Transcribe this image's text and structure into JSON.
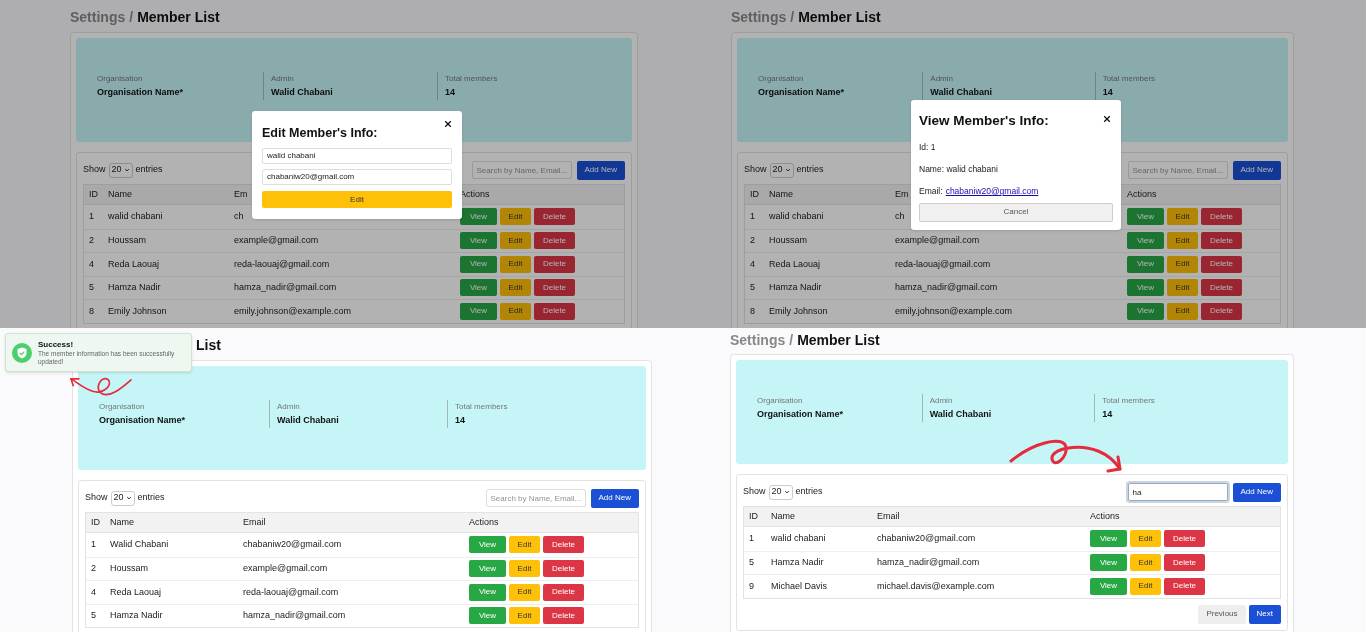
{
  "panels": [
    {
      "breadcrumb": {
        "parent": "Settings",
        "separator": "/",
        "current": "Member List"
      },
      "summary": [
        {
          "label": "Organisation",
          "value": "Organisation Name*"
        },
        {
          "label": "Admin",
          "value": "Walid Chabani"
        },
        {
          "label": "Total members",
          "value": "14"
        }
      ],
      "toolbar": {
        "show": "Show",
        "page_size": "20",
        "entries": "entries",
        "search": {
          "placeholder": "Search by Name, Email...",
          "focused": false
        },
        "add_button": "Add New"
      },
      "table": {
        "columns": [
          "ID",
          "Name",
          "Em",
          "Actions"
        ],
        "rows": [
          {
            "id": "1",
            "name": "walid chabani",
            "email": "ch",
            "actions": [
              "View",
              "Edit",
              "Delete"
            ]
          },
          {
            "id": "2",
            "name": "Houssam",
            "email": "example@gmail.com",
            "actions": [
              "View",
              "Edit",
              "Delete"
            ]
          },
          {
            "id": "4",
            "name": "Reda Laouaj",
            "email": "reda-laouaj@gmail.com",
            "actions": [
              "View",
              "Edit",
              "Delete"
            ]
          },
          {
            "id": "5",
            "name": "Hamza Nadir",
            "email": "hamza_nadir@gmail.com",
            "actions": [
              "View",
              "Edit",
              "Delete"
            ]
          },
          {
            "id": "8",
            "name": "Emily Johnson",
            "email": "emily.johnson@example.com",
            "actions": [
              "View",
              "Edit",
              "Delete"
            ]
          }
        ]
      },
      "dimmed": true,
      "annotation_arrow": false,
      "overlay": {
        "kind": "edit_modal",
        "title": "Edit Member's Info:",
        "fields": [
          "walid chabani",
          "chabaniw20@gmail.com"
        ],
        "button": "Edit"
      }
    },
    {
      "breadcrumb": {
        "parent": "Settings",
        "separator": "/",
        "current": "Member List"
      },
      "summary": [
        {
          "label": "Organisation",
          "value": "Organisation Name*"
        },
        {
          "label": "Admin",
          "value": "Walid Chabani"
        },
        {
          "label": "Total members",
          "value": "14"
        }
      ],
      "toolbar": {
        "show": "Show",
        "page_size": "20",
        "entries": "entries",
        "search": {
          "placeholder": "Search by Name, Email...",
          "focused": false
        },
        "add_button": "Add New"
      },
      "table": {
        "columns": [
          "ID",
          "Name",
          "Em",
          "Actions"
        ],
        "rows": [
          {
            "id": "1",
            "name": "walid chabani",
            "email": "ch",
            "actions": [
              "View",
              "Edit",
              "Delete"
            ]
          },
          {
            "id": "2",
            "name": "Houssam",
            "email": "example@gmail.com",
            "actions": [
              "View",
              "Edit",
              "Delete"
            ]
          },
          {
            "id": "4",
            "name": "Reda Laouaj",
            "email": "reda-laouaj@gmail.com",
            "actions": [
              "View",
              "Edit",
              "Delete"
            ]
          },
          {
            "id": "5",
            "name": "Hamza Nadir",
            "email": "hamza_nadir@gmail.com",
            "actions": [
              "View",
              "Edit",
              "Delete"
            ]
          },
          {
            "id": "8",
            "name": "Emily Johnson",
            "email": "emily.johnson@example.com",
            "actions": [
              "View",
              "Edit",
              "Delete"
            ]
          }
        ]
      },
      "dimmed": true,
      "annotation_arrow": false,
      "overlay": {
        "kind": "view_modal",
        "title": "View Member's Info:",
        "lines": [
          "Id: 1",
          "Name: walid chabani"
        ],
        "email_label": "Email:",
        "email_link": "chabaniw20@gmail.com",
        "button": "Cancel"
      }
    },
    {
      "breadcrumb": {
        "current": "List"
      },
      "summary": [
        {
          "label": "Organisation",
          "value": "Organisation Name*"
        },
        {
          "label": "Admin",
          "value": "Walid Chabani"
        },
        {
          "label": "Total members",
          "value": "14"
        }
      ],
      "toolbar": {
        "show": "Show",
        "page_size": "20",
        "entries": "entries",
        "search": {
          "placeholder": "Search by Name, Email...",
          "focused": false
        },
        "add_button": "Add New"
      },
      "table": {
        "columns": [
          "ID",
          "Name",
          "Email",
          "Actions"
        ],
        "rows": [
          {
            "id": "1",
            "name": "Walid Chabani",
            "email": "chabaniw20@gmail.com",
            "actions": [
              "View",
              "Edit",
              "Delete"
            ]
          },
          {
            "id": "2",
            "name": "Houssam",
            "email": "example@gmail.com",
            "actions": [
              "View",
              "Edit",
              "Delete"
            ]
          },
          {
            "id": "4",
            "name": "Reda Laouaj",
            "email": "reda-laouaj@gmail.com",
            "actions": [
              "View",
              "Edit",
              "Delete"
            ]
          },
          {
            "id": "5",
            "name": "Hamza Nadir",
            "email": "hamza_nadir@gmail.com",
            "actions": [
              "View",
              "Edit",
              "Delete"
            ]
          }
        ]
      },
      "dimmed": false,
      "annotation_arrow": true,
      "overlay": {
        "kind": "toast",
        "title": "Success!",
        "message": "The member information has been successfully updated!"
      }
    },
    {
      "breadcrumb": {
        "parent": "Settings",
        "separator": "/",
        "current": "Member List"
      },
      "summary": [
        {
          "label": "Organisation",
          "value": "Organisation Name*"
        },
        {
          "label": "Admin",
          "value": "Walid Chabani"
        },
        {
          "label": "Total members",
          "value": "14"
        }
      ],
      "toolbar": {
        "show": "Show",
        "page_size": "20",
        "entries": "entries",
        "search": {
          "value": "ha",
          "focused": true
        },
        "add_button": "Add New"
      },
      "table": {
        "columns": [
          "ID",
          "Name",
          "Email",
          "Actions"
        ],
        "rows": [
          {
            "id": "1",
            "name": "walid chabani",
            "email": "chabaniw20@gmail.com",
            "actions": [
              "View",
              "Edit",
              "Delete"
            ]
          },
          {
            "id": "5",
            "name": "Hamza Nadir",
            "email": "hamza_nadir@gmail.com",
            "actions": [
              "View",
              "Edit",
              "Delete"
            ]
          },
          {
            "id": "9",
            "name": "Michael Davis",
            "email": "michael.davis@example.com",
            "actions": [
              "View",
              "Edit",
              "Delete"
            ]
          }
        ]
      },
      "dimmed": false,
      "annotation_arrow": true,
      "pagination": [
        "Previous",
        "Next"
      ]
    }
  ]
}
